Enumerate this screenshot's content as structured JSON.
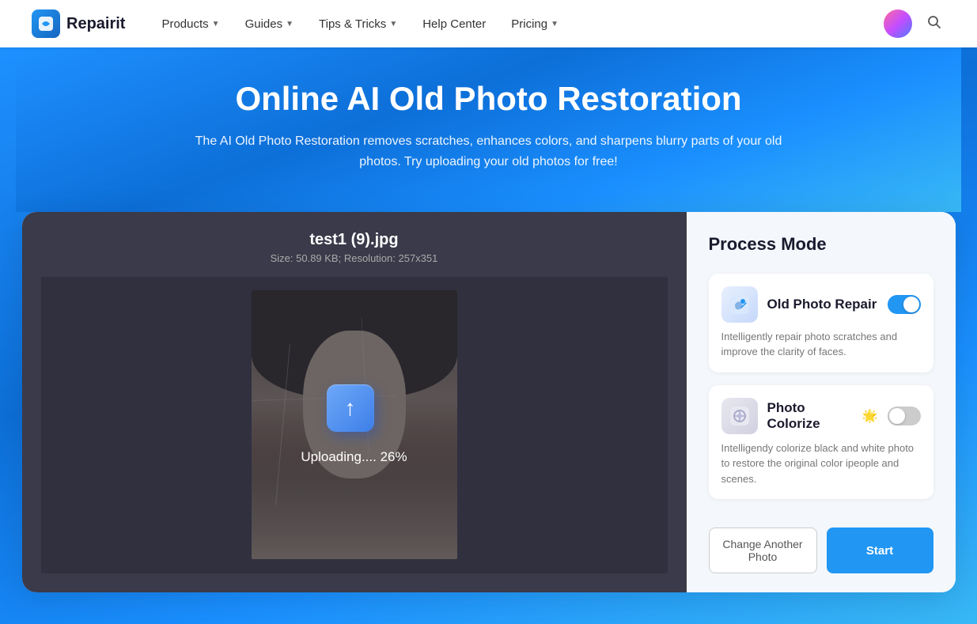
{
  "navbar": {
    "logo_text": "Repairit",
    "logo_icon": "R",
    "nav_items": [
      {
        "label": "Products",
        "has_dropdown": true
      },
      {
        "label": "Guides",
        "has_dropdown": true
      },
      {
        "label": "Tips & Tricks",
        "has_dropdown": true
      },
      {
        "label": "Help Center",
        "has_dropdown": false
      },
      {
        "label": "Pricing",
        "has_dropdown": true
      }
    ]
  },
  "hero": {
    "title": "Online AI Old Photo Restoration",
    "subtitle": "The AI Old Photo Restoration removes scratches, enhances colors, and sharpens blurry parts of your old photos. Try uploading your old photos for free!"
  },
  "upload_panel": {
    "file_name": "test1 (9).jpg",
    "file_meta": "Size: 50.89 KB; Resolution: 257x351",
    "uploading_label": "Uploading.... 26%"
  },
  "process_panel": {
    "title": "Process Mode",
    "options": [
      {
        "label": "Old Photo Repair",
        "description": "Intelligently repair photo scratches and improve the clarity of faces.",
        "toggle_on": true,
        "icon": "🔧",
        "badge": ""
      },
      {
        "label": "Photo Colorize",
        "description": "Intelligendy colorize black and white photo to restore the original color ipeople and scenes.",
        "toggle_on": false,
        "icon": "🎨",
        "badge": "🌟"
      }
    ],
    "btn_change": "Change Another Photo",
    "btn_start": "Start"
  }
}
